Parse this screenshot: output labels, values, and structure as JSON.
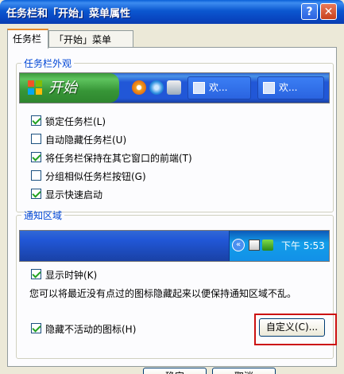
{
  "window": {
    "title": "任务栏和「开始」菜单属性",
    "help_glyph": "?",
    "close_glyph": "✕"
  },
  "tabs": [
    {
      "label": "任务栏",
      "active": true
    },
    {
      "label": "「开始」菜单",
      "active": false
    }
  ],
  "appearance": {
    "legend": "任务栏外观",
    "preview": {
      "start_label": "开始",
      "task_buttons": [
        {
          "label": "欢..."
        },
        {
          "label": "欢..."
        }
      ]
    },
    "options": [
      {
        "label": "锁定任务栏(L)",
        "checked": true
      },
      {
        "label": "自动隐藏任务栏(U)",
        "checked": false
      },
      {
        "label": "将任务栏保持在其它窗口的前端(T)",
        "checked": true
      },
      {
        "label": "分组相似任务栏按钮(G)",
        "checked": false
      },
      {
        "label": "显示快速启动",
        "checked": true
      }
    ]
  },
  "notification": {
    "legend": "通知区域",
    "tray": {
      "chevron": "«",
      "clock": "下午 5:53"
    },
    "show_clock": {
      "label": "显示时钟(K)",
      "checked": true
    },
    "note": "您可以将最近没有点过的图标隐藏起来以便保持通知区域不乱。",
    "hide_inactive": {
      "label": "隐藏不活动的图标(H)",
      "checked": true
    },
    "customize_label": "自定义(C)..."
  },
  "footer": {
    "ok_label": "确定",
    "cancel_label": "取消"
  },
  "colors": {
    "accent_title": "#0846c4",
    "highlight": "#cc1111",
    "legend": "#0046d5"
  }
}
